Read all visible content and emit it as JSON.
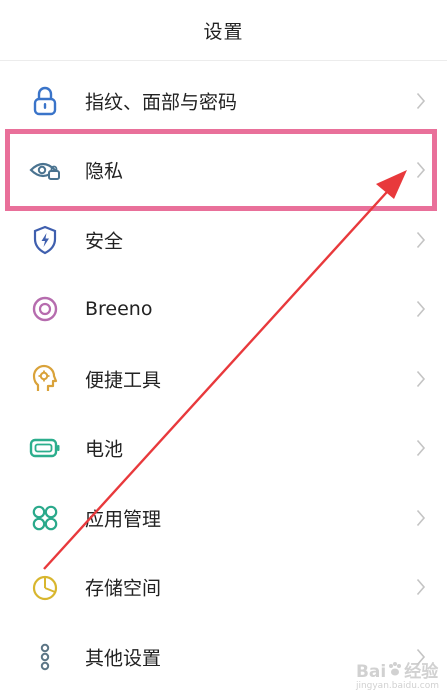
{
  "header": {
    "title": "设置"
  },
  "items": [
    {
      "label": "指纹、面部与密码",
      "icon": "lock-icon",
      "color": "#3a74c9"
    },
    {
      "label": "隐私",
      "icon": "eye-lock-icon",
      "color": "#4a7390"
    },
    {
      "label": "安全",
      "icon": "shield-bolt-icon",
      "color": "#3f5fae"
    },
    {
      "label": "Breeno",
      "icon": "breeno-ring-icon",
      "color": "#b66cae"
    },
    {
      "label": "便捷工具",
      "icon": "assistant-head-icon",
      "color": "#d9a23a"
    },
    {
      "label": "电池",
      "icon": "battery-icon",
      "color": "#2cae8d"
    },
    {
      "label": "应用管理",
      "icon": "app-grid-icon",
      "color": "#2aa98b"
    },
    {
      "label": "存储空间",
      "icon": "pie-chart-icon",
      "color": "#d8b62e"
    },
    {
      "label": "其他设置",
      "icon": "more-dots-icon",
      "color": "#5d7686"
    }
  ],
  "annotation": {
    "highlight_color": "#e9709a",
    "arrow_color": "#e8393c"
  },
  "watermark": {
    "brand": "Bai",
    "brand_suffix": "经验",
    "url": "jingyan.baidu.com"
  }
}
